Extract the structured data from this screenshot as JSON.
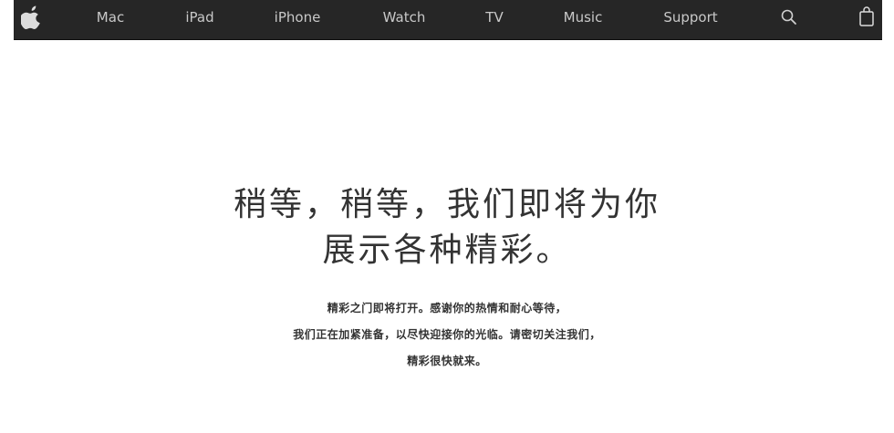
{
  "nav": {
    "items": [
      {
        "label": "Mac"
      },
      {
        "label": "iPad"
      },
      {
        "label": "iPhone"
      },
      {
        "label": "Watch"
      },
      {
        "label": "TV"
      },
      {
        "label": "Music"
      },
      {
        "label": "Support"
      }
    ],
    "icons": {
      "logo": "apple-logo-icon",
      "search": "search-icon",
      "bag": "shopping-bag-icon"
    },
    "background_color": "#262626",
    "text_color": "#c8c8c8"
  },
  "hero": {
    "headline_line1": "稍等，稍等，我们即将为你",
    "headline_line2": "展示各种精彩。",
    "body_line1": "精彩之门即将打开。感谢你的热情和耐心等待，",
    "body_line2": "我们正在加紧准备，以尽快迎接你的光临。请密切关注我们，",
    "body_line3": "精彩很快就来。",
    "text_color": "#333333"
  }
}
